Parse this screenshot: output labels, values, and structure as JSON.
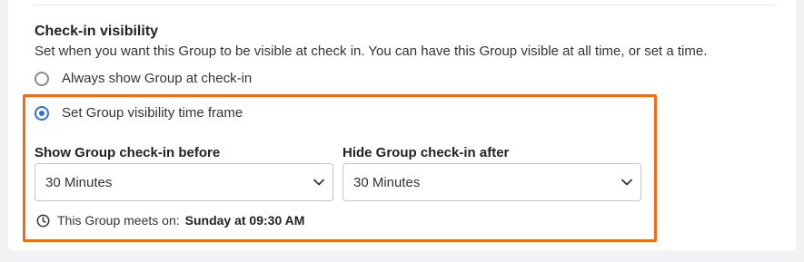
{
  "section": {
    "title": "Check-in visibility",
    "description": "Set when you want this Group to be visible at check in. You can have this Group visible at all time, or set a time."
  },
  "visibility_options": [
    {
      "label": "Always show Group at check-in",
      "selected": false
    },
    {
      "label": "Set Group visibility time frame",
      "selected": true
    }
  ],
  "timeframe": {
    "show_before": {
      "label": "Show Group check-in before",
      "value": "30 Minutes"
    },
    "hide_after": {
      "label": "Hide Group check-in after",
      "value": "30 Minutes"
    }
  },
  "meeting": {
    "prefix": "This Group meets on:",
    "time": "Sunday at 09:30 AM",
    "icon": "clock-icon"
  },
  "colors": {
    "highlight_border": "#f26b12",
    "radio_selected": "#2f6fde"
  }
}
